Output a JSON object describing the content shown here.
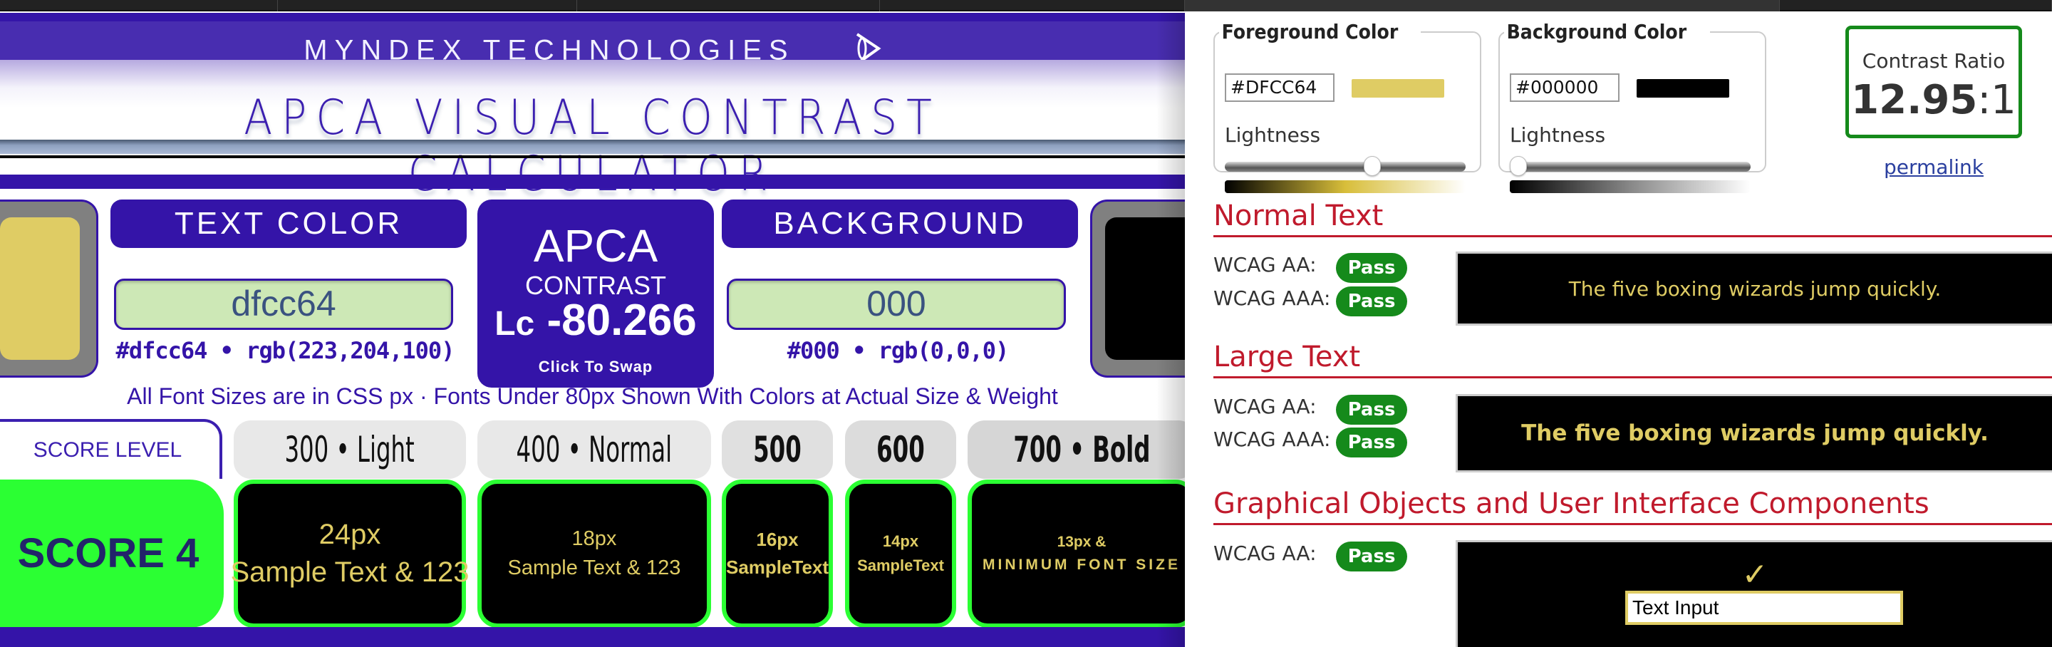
{
  "left": {
    "brand": "MYNDEX TECHNOLOGIES",
    "brand_logo_icon": "eye-logo-icon",
    "title": "APCA VISUAL CONTRAST CALCULATOR",
    "text_color": {
      "header": "TEXT COLOR",
      "value": "dfcc64",
      "caption": "#dfcc64 • rgb(223,204,100)",
      "swatch": "#dfcc64"
    },
    "background": {
      "header": "BACKGROUND",
      "value": "000",
      "caption": "#000 • rgb(0,0,0)",
      "swatch": "#000000"
    },
    "apca": {
      "title": "APCA",
      "subtitle": "CONTRAST",
      "lc_symbol": "Lc",
      "value": "-80.266",
      "swap_label": "Click To Swap"
    },
    "note": "All Font Sizes are in CSS px · Fonts Under 80px Shown With Colors at Actual Size & Weight",
    "score_tab": "SCORE LEVEL",
    "weights": [
      "300 • Light",
      "400 • Normal",
      "500",
      "600",
      "700 • Bold"
    ],
    "score": "SCORE 4",
    "samples": [
      {
        "size": "24px",
        "text": "Sample Text & 123"
      },
      {
        "size": "18px",
        "text": "Sample Text & 123"
      },
      {
        "size": "16px",
        "text": "SampleText"
      },
      {
        "size": "14px",
        "text": "SampleText"
      },
      {
        "size": "13px &",
        "text": "MINIMUM FONT SIZE"
      }
    ]
  },
  "right": {
    "foreground": {
      "legend": "Foreground Color",
      "hex": "#DFCC64",
      "chip": "#dfcc64",
      "lightness_label": "Lightness",
      "lightness": 0.62
    },
    "background": {
      "legend": "Background Color",
      "hex": "#000000",
      "chip": "#000000",
      "lightness_label": "Lightness",
      "lightness": 0.0
    },
    "contrast": {
      "label": "Contrast Ratio",
      "value": "12.95",
      "suffix": ":1"
    },
    "permalink": "permalink",
    "sections": [
      {
        "title": "Normal Text",
        "rows": [
          {
            "label": "WCAG AA:",
            "result": "Pass"
          },
          {
            "label": "WCAG AAA:",
            "result": "Pass"
          }
        ],
        "demo": "The five boxing wizards jump quickly."
      },
      {
        "title": "Large Text",
        "rows": [
          {
            "label": "WCAG AA:",
            "result": "Pass"
          },
          {
            "label": "WCAG AAA:",
            "result": "Pass"
          }
        ],
        "demo": "The five boxing wizards jump quickly."
      },
      {
        "title": "Graphical Objects and User Interface Components",
        "rows": [
          {
            "label": "WCAG AA:",
            "result": "Pass"
          }
        ],
        "demo_check": "✓",
        "demo_input": "Text Input"
      }
    ]
  }
}
